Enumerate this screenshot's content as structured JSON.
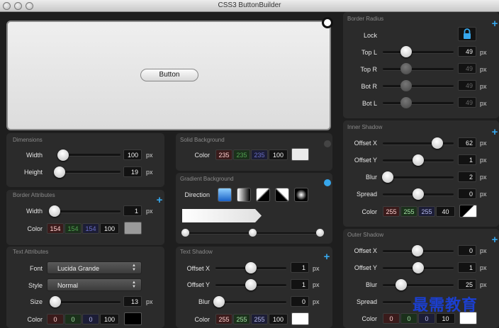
{
  "window": {
    "title": "CSS3 ButtonBuilder"
  },
  "preview": {
    "button_label": "Button"
  },
  "dimensions": {
    "title": "Dimensions",
    "width_label": "Width",
    "width_value": "100",
    "width_unit": "px",
    "height_label": "Height",
    "height_value": "19",
    "height_unit": "px"
  },
  "border_attributes": {
    "title": "Border Attributes",
    "width_label": "Width",
    "width_value": "1",
    "width_unit": "px",
    "color_label": "Color",
    "r": "154",
    "g": "154",
    "b": "154",
    "a": "100",
    "swatch": "#9a9a9a"
  },
  "text_attributes": {
    "title": "Text Attributes",
    "font_label": "Font",
    "font_value": "Lucida Grande",
    "style_label": "Style",
    "style_value": "Normal",
    "size_label": "Size",
    "size_value": "13",
    "size_unit": "px",
    "color_label": "Color",
    "r": "0",
    "g": "0",
    "b": "0",
    "a": "100",
    "swatch": "#000000"
  },
  "solid_background": {
    "title": "Solid Background",
    "color_label": "Color",
    "r": "235",
    "g": "235",
    "b": "235",
    "a": "100",
    "swatch": "#ebebeb"
  },
  "gradient_background": {
    "title": "Gradient Background",
    "direction_label": "Direction",
    "directions": [
      "vertical",
      "horizontal",
      "diagonal-down",
      "diagonal-up",
      "radial"
    ]
  },
  "text_shadow": {
    "title": "Text Shadow",
    "offset_x_label": "Offset X",
    "offset_x": "1",
    "offset_x_unit": "px",
    "offset_y_label": "Offset Y",
    "offset_y": "1",
    "offset_y_unit": "px",
    "blur_label": "Blur",
    "blur": "0",
    "blur_unit": "px",
    "color_label": "Color",
    "r": "255",
    "g": "255",
    "b": "255",
    "a": "100",
    "swatch": "#ffffff"
  },
  "border_radius": {
    "title": "Border Radius",
    "lock_label": "Lock",
    "top_l_label": "Top L",
    "top_l": "49",
    "top_l_unit": "px",
    "top_r_label": "Top R",
    "top_r": "49",
    "top_r_unit": "px",
    "bot_r_label": "Bot R",
    "bot_r": "49",
    "bot_r_unit": "px",
    "bot_l_label": "Bot L",
    "bot_l": "49",
    "bot_l_unit": "px"
  },
  "inner_shadow": {
    "title": "Inner Shadow",
    "offset_x_label": "Offset X",
    "offset_x": "62",
    "offset_x_unit": "px",
    "offset_y_label": "Offset Y",
    "offset_y": "1",
    "offset_y_unit": "px",
    "blur_label": "Blur",
    "blur": "2",
    "blur_unit": "px",
    "spread_label": "Spread",
    "spread": "0",
    "spread_unit": "px",
    "color_label": "Color",
    "r": "255",
    "g": "255",
    "b": "255",
    "a": "40"
  },
  "outer_shadow": {
    "title": "Outer Shadow",
    "offset_x_label": "Offset X",
    "offset_x": "0",
    "offset_x_unit": "px",
    "offset_y_label": "Offset Y",
    "offset_y": "1",
    "offset_y_unit": "px",
    "blur_label": "Blur",
    "blur": "25",
    "blur_unit": "px",
    "spread_label": "Spread",
    "color_label": "Color",
    "r": "0",
    "g": "0",
    "b": "0",
    "a": "10"
  },
  "colors": {
    "accent": "#37a7ec",
    "panel": "#2b2b2b",
    "background": "#1e1e1e"
  },
  "watermark": "最需教育"
}
